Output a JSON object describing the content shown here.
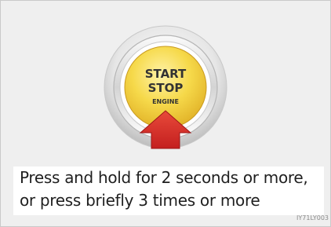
{
  "button": {
    "line1": "START",
    "line2": "STOP",
    "line3": "ENGINE"
  },
  "caption": {
    "line1": "Press and hold for 2 seconds or more,",
    "line2": "or press briefly 3 times or more"
  },
  "figure_code": "IY71LY003",
  "colors": {
    "button_face": "#f3d54a",
    "arrow": "#d63031",
    "background": "#efefef"
  },
  "icons": {
    "button": "start-stop-engine-button-icon",
    "arrow": "press-arrow-icon"
  }
}
